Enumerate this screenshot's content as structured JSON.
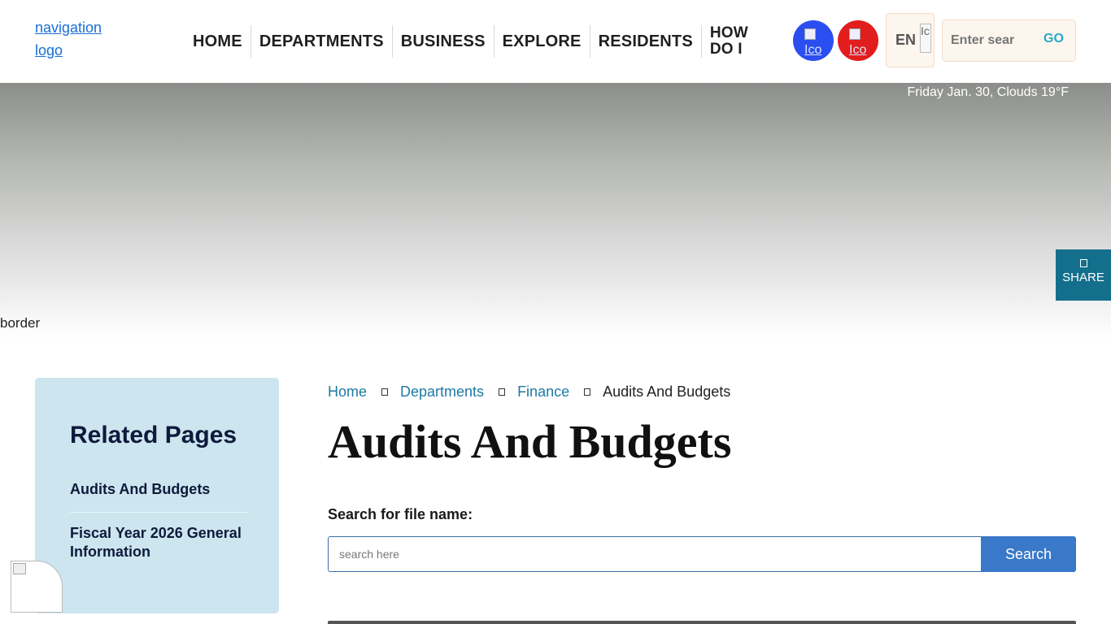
{
  "header": {
    "logo_alt": "navigation logo",
    "nav": [
      "HOME",
      "DEPARTMENTS",
      "BUSINESS",
      "EXPLORE",
      "RESIDENTS",
      "HOW DO I"
    ],
    "icon_blue_alt": "Ico",
    "icon_red_alt": "Ico",
    "language": "EN",
    "flag_alt": "Ic",
    "search_placeholder": "Enter sear",
    "search_go": "GO",
    "colors": {
      "accent": "#2aa7c8",
      "blue_icon": "#2b4ef0",
      "red_icon": "#e21d1d"
    }
  },
  "hero": {
    "weather": "Friday Jan. 30, Clouds 19°F",
    "border_alt": "border",
    "share_label": "SHARE",
    "share_color": "#146f8c"
  },
  "sidebar": {
    "title": "Related Pages",
    "links": [
      "Audits And Budgets",
      "Fiscal Year 2026 General Information"
    ],
    "background": "#cce5ef"
  },
  "breadcrumb": [
    "Home",
    "Departments",
    "Finance",
    "Audits And Budgets"
  ],
  "page_title": "Audits And Budgets",
  "file_search": {
    "label": "Search for file name:",
    "placeholder": "search here",
    "button": "Search",
    "button_color": "#3a78c9"
  }
}
